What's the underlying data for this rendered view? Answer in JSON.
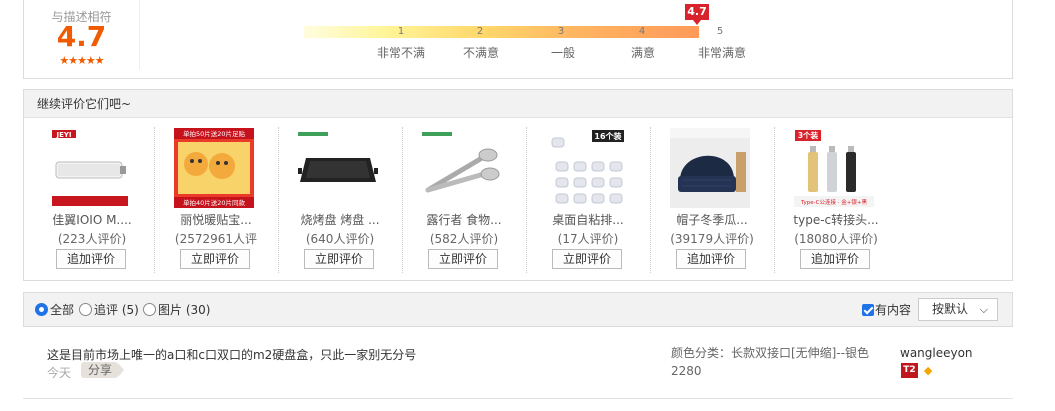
{
  "rating": {
    "label": "与描述相符",
    "score": "4.7",
    "stars": "★★★★★",
    "flag": "4.7",
    "scale_numbers": [
      "1",
      "2",
      "3",
      "4",
      "5"
    ],
    "scale_labels": [
      "非常不满",
      "不满意",
      "一般",
      "满意",
      "非常满意"
    ],
    "score_fraction": 0.94
  },
  "continue_review": {
    "title": "继续评价它们吧~",
    "products": [
      {
        "name": "佳翼IOIO M....",
        "count": "(223人评价)",
        "button": "追加评价",
        "image": "ssd-enclosure"
      },
      {
        "name": "丽悦暖贴宝...",
        "count": "(2572961人评",
        "button": "立即评价",
        "image": "heat-pack"
      },
      {
        "name": "烧烤盘 烤盘 ...",
        "count": "(640人评价)",
        "button": "立即评价",
        "image": "bbq-tray"
      },
      {
        "name": "露行者 食物...",
        "count": "(582人评价)",
        "button": "立即评价",
        "image": "food-tongs"
      },
      {
        "name": "桌面自粘排...",
        "count": "(17人评价)",
        "button": "立即评价",
        "image": "cable-clips"
      },
      {
        "name": "帽子冬季瓜...",
        "count": "(39179人评价)",
        "button": "追加评价",
        "image": "winter-hat"
      },
      {
        "name": "type-c转接头...",
        "count": "(18080人评价)",
        "button": "追加评价",
        "image": "type-c-adapter"
      }
    ],
    "image_text": {
      "jeyi_logo": "JEYI",
      "heat_top": "单拍50片送20片足贴",
      "heat_bottom": "单拍40片送20片同款",
      "clips_badge": "16个装",
      "adapter_badge": "3个装",
      "adapter_strip": "Type-C公连接 · 金+银+黑"
    }
  },
  "filter": {
    "options": [
      {
        "label": "全部",
        "checked": true
      },
      {
        "label": "追评 (5)",
        "checked": false
      },
      {
        "label": "图片 (30)",
        "checked": false
      }
    ],
    "has_content_label": "有内容",
    "sort_label": "按默认",
    "chevron": "chevron-down-icon"
  },
  "review": {
    "text": "这是目前市场上唯一的a口和c口双口的m2硬盘盒，只此一家别无分号",
    "date": "今天",
    "share_label": "分享",
    "sku": "颜色分类：长款双接口[无伸缩]--银色2280",
    "user": "wangleeyon",
    "level": "T2"
  },
  "colors": {
    "accent": "#f05a00",
    "flag": "#d8232c",
    "checked_blue": "#1f73e6"
  }
}
